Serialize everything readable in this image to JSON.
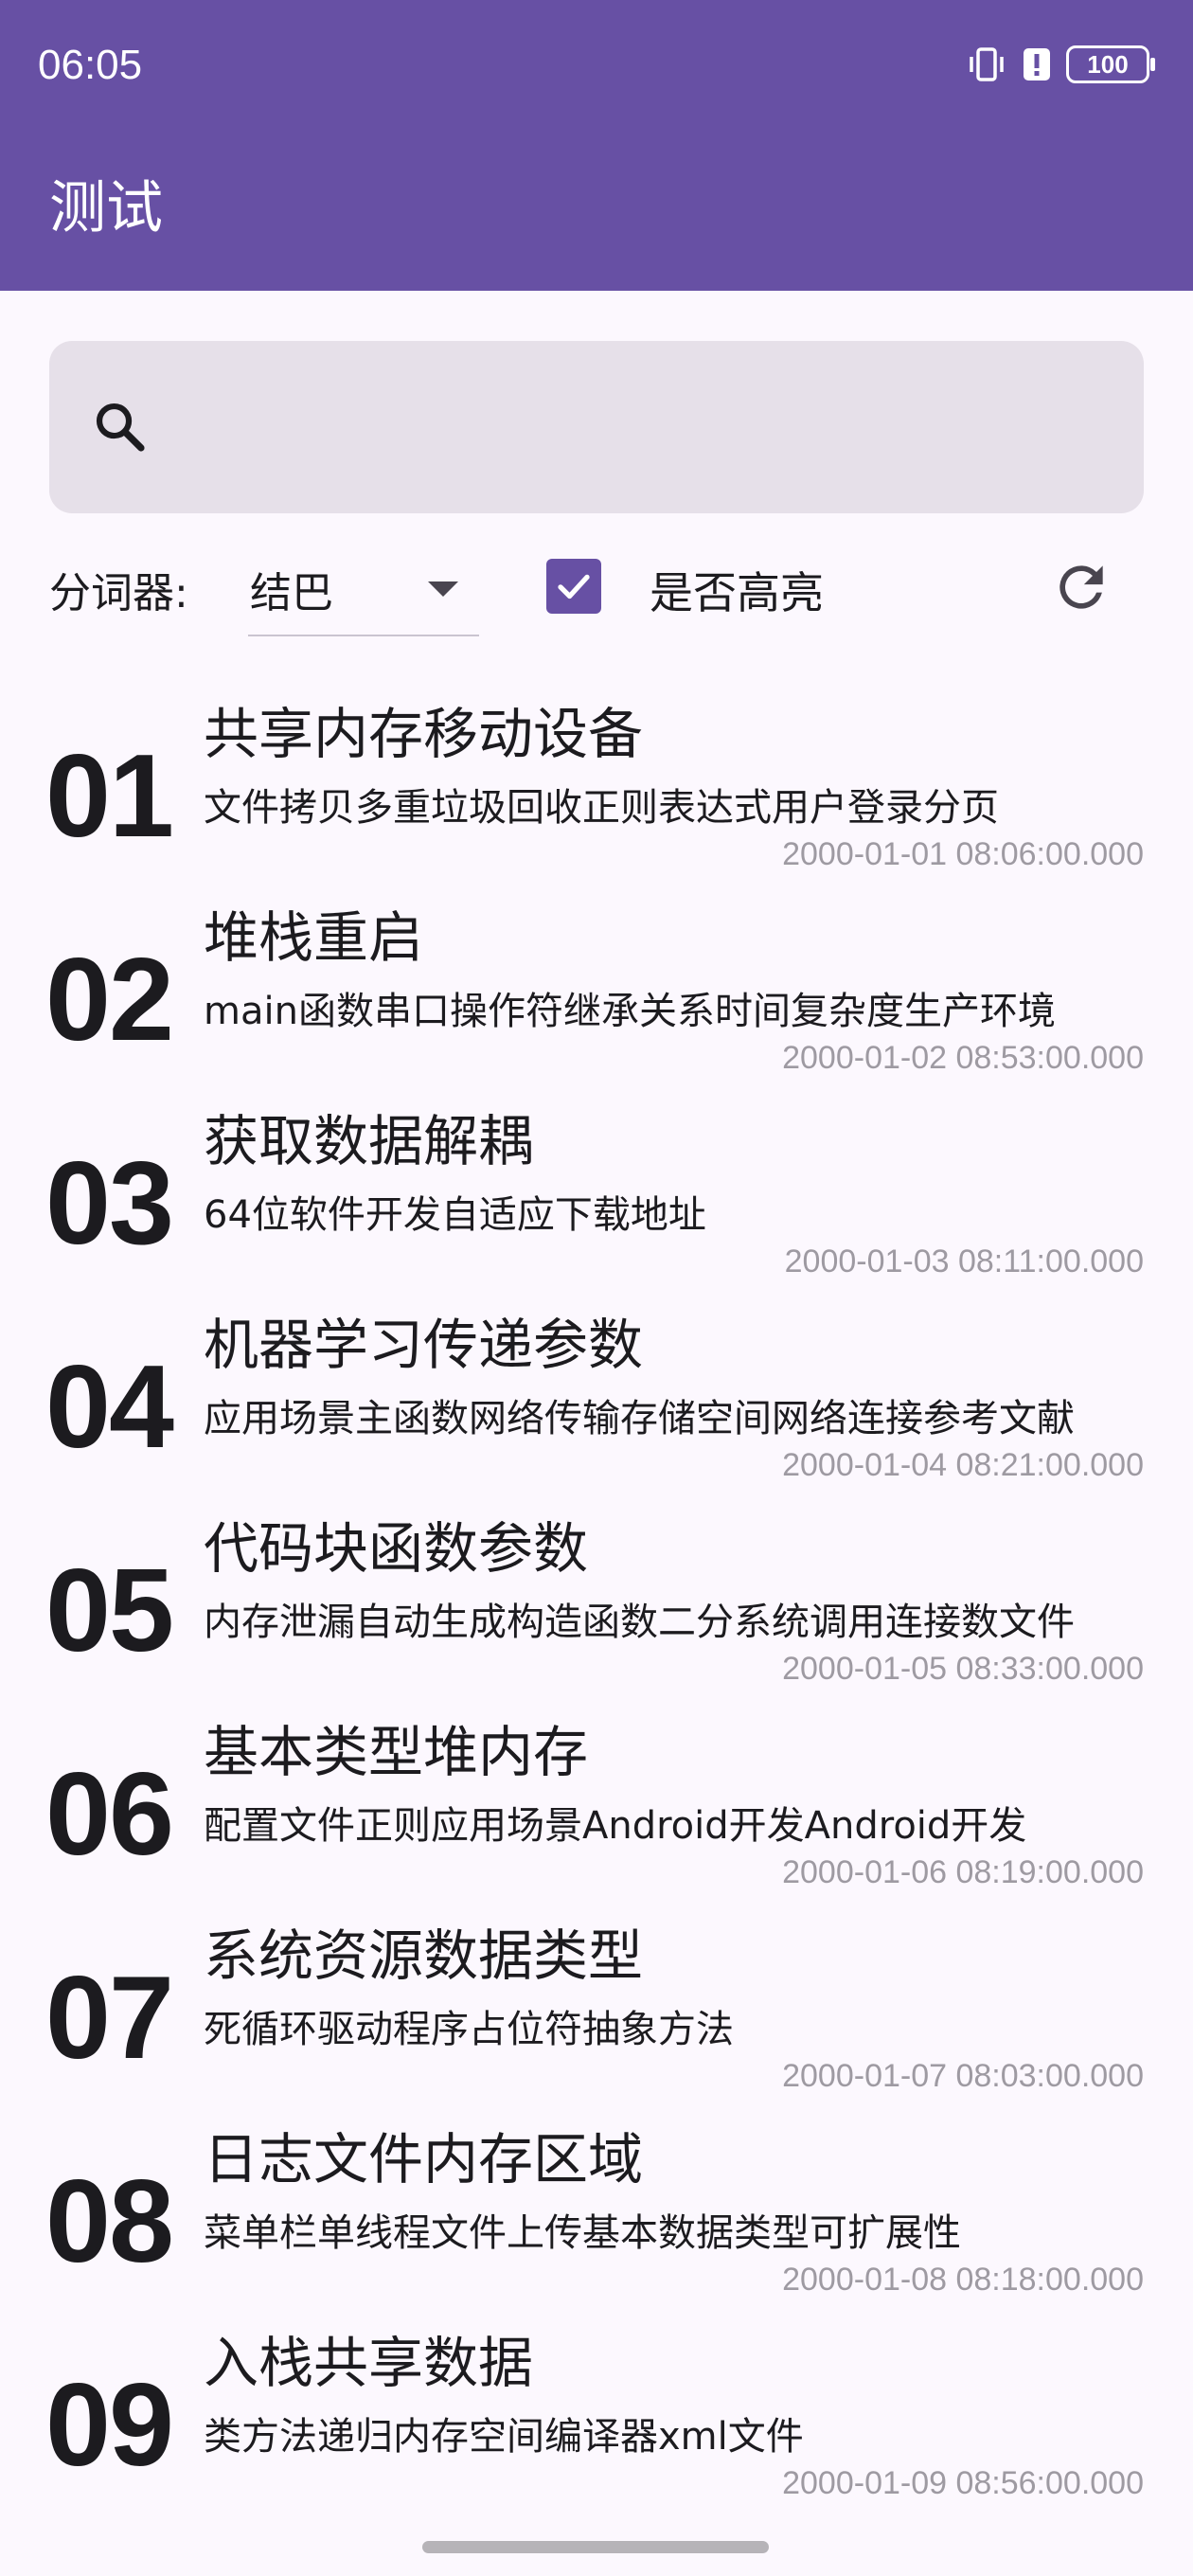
{
  "status_bar": {
    "time": "06:05",
    "battery": "100"
  },
  "app_bar": {
    "title": "测试"
  },
  "search": {
    "value": "",
    "placeholder": ""
  },
  "controls": {
    "segmenter_label": "分词器:",
    "segmenter_value": "结巴",
    "highlight_label": "是否高亮",
    "highlight_checked": true
  },
  "accent_color": "#6750A4",
  "items": [
    {
      "num": "01",
      "title": "共享内存移动设备",
      "subtitle": "文件拷贝多重垃圾回收正则表达式用户登录分页",
      "date": "2000-01-01 08:06:00.000"
    },
    {
      "num": "02",
      "title": "堆栈重启",
      "subtitle": "main函数串口操作符继承关系时间复杂度生产环境",
      "date": "2000-01-02 08:53:00.000"
    },
    {
      "num": "03",
      "title": "获取数据解耦",
      "subtitle": "64位软件开发自适应下载地址",
      "date": "2000-01-03 08:11:00.000"
    },
    {
      "num": "04",
      "title": "机器学习传递参数",
      "subtitle": "应用场景主函数网络传输存储空间网络连接参考文献",
      "date": "2000-01-04 08:21:00.000"
    },
    {
      "num": "05",
      "title": "代码块函数参数",
      "subtitle": "内存泄漏自动生成构造函数二分系统调用连接数文件",
      "date": "2000-01-05 08:33:00.000"
    },
    {
      "num": "06",
      "title": "基本类型堆内存",
      "subtitle": "配置文件正则应用场景Android开发Android开发",
      "date": "2000-01-06 08:19:00.000"
    },
    {
      "num": "07",
      "title": "系统资源数据类型",
      "subtitle": "死循环驱动程序占位符抽象方法",
      "date": "2000-01-07 08:03:00.000"
    },
    {
      "num": "08",
      "title": "日志文件内存区域",
      "subtitle": "菜单栏单线程文件上传基本数据类型可扩展性",
      "date": "2000-01-08 08:18:00.000"
    },
    {
      "num": "09",
      "title": "入栈共享数据",
      "subtitle": "类方法递归内存空间编译器xml文件",
      "date": "2000-01-09 08:56:00.000"
    }
  ]
}
